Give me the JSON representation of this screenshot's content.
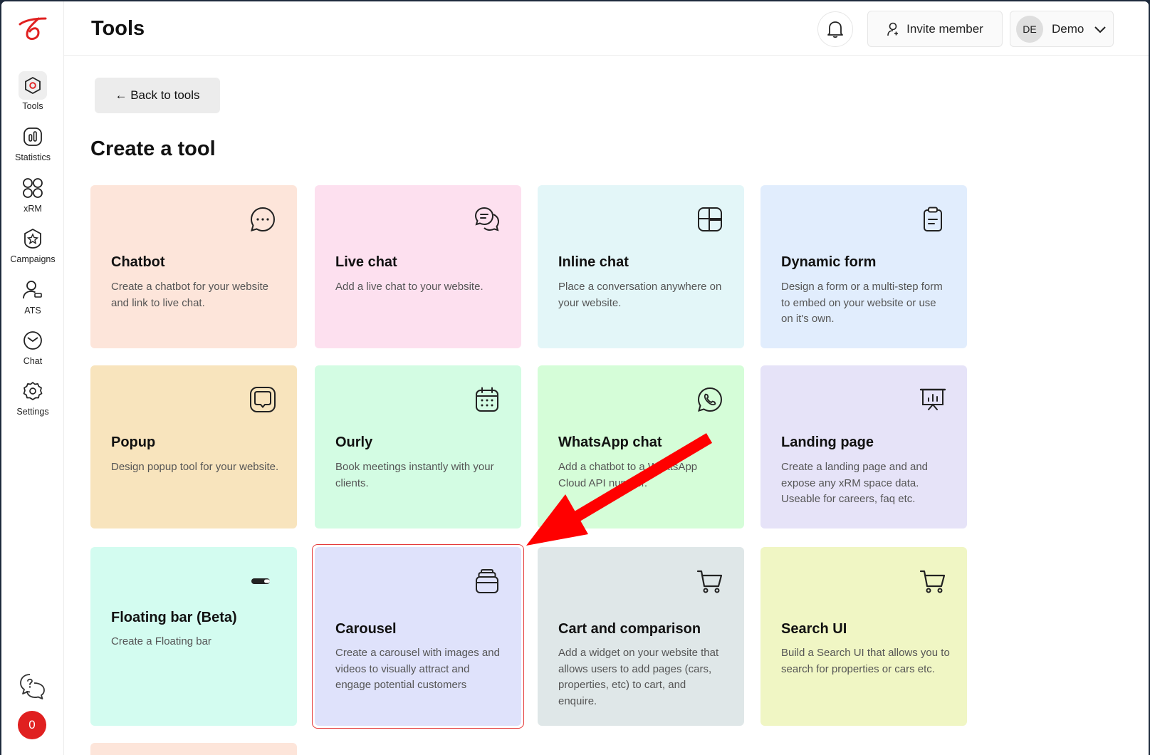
{
  "colors": {
    "brand": "#e02020",
    "active_nav_bg": "#eeeeee",
    "annotation": "#ff0000"
  },
  "header": {
    "title": "Tools",
    "invite_label": "Invite member",
    "avatar_initials": "DE",
    "user_name": "Demo"
  },
  "sidebar": {
    "items": [
      {
        "label": "Tools",
        "icon": "tools-hexagon-icon",
        "active": true
      },
      {
        "label": "Statistics",
        "icon": "statistics-icon",
        "active": false
      },
      {
        "label": "xRM",
        "icon": "grid-circles-icon",
        "active": false
      },
      {
        "label": "Campaigns",
        "icon": "campaigns-badge-icon",
        "active": false
      },
      {
        "label": "ATS",
        "icon": "user-tag-icon",
        "active": false
      },
      {
        "label": "Chat",
        "icon": "chat-bubble-icon",
        "active": false
      },
      {
        "label": "Settings",
        "icon": "gear-icon",
        "active": false
      }
    ],
    "badge_count": "0"
  },
  "main": {
    "back_label": "← Back to tools",
    "heading": "Create a tool",
    "tools": [
      {
        "title": "Chatbot",
        "description": "Create a chatbot for your website and link to live chat.",
        "color": "#fde5da",
        "icon": "chat-dots-icon"
      },
      {
        "title": "Live chat",
        "description": "Add a live chat to your website.",
        "color": "#fde0ef",
        "icon": "chat-bubbles-icon"
      },
      {
        "title": "Inline chat",
        "description": "Place a conversation anywhere on your website.",
        "color": "#e3f6f8",
        "icon": "layout-grid-icon"
      },
      {
        "title": "Dynamic form",
        "description": "Design a form or a multi-step form to embed on your website or use on it's own.",
        "color": "#e1edfd",
        "icon": "clipboard-icon"
      },
      {
        "title": "Popup",
        "description": "Design popup tool for your website.",
        "color": "#f8e4bd",
        "icon": "popup-square-icon"
      },
      {
        "title": "Ourly",
        "description": "Book meetings instantly with your clients.",
        "color": "#d3fce3",
        "icon": "calendar-icon"
      },
      {
        "title": "WhatsApp chat",
        "description": "Add a chatbot to a WhatsApp Cloud API number.",
        "color": "#d5fdd8",
        "icon": "whatsapp-icon"
      },
      {
        "title": "Landing page",
        "description": "Create a landing page and and expose any xRM space data. Useable for careers, faq etc.",
        "color": "#e6e3f8",
        "icon": "presentation-board-icon"
      },
      {
        "title": "Floating bar (Beta)",
        "description": "Create a Floating bar",
        "color": "#d3fcf0",
        "icon": "floating-bar-icon"
      },
      {
        "title": "Carousel",
        "description": "Create a carousel with images and videos to visually attract and engage potential customers",
        "color": "#dfe2fb",
        "icon": "stacked-cards-icon"
      },
      {
        "title": "Cart and comparison",
        "description": "Add a widget on your website that allows users to add pages (cars, properties, etc) to cart, and enquire.",
        "color": "#dfe7e8",
        "icon": "shopping-cart-icon"
      },
      {
        "title": "Search UI",
        "description": "Build a Search UI that allows you to search for properties or cars etc.",
        "color": "#f0f6c4",
        "icon": "shopping-cart-icon"
      }
    ]
  }
}
